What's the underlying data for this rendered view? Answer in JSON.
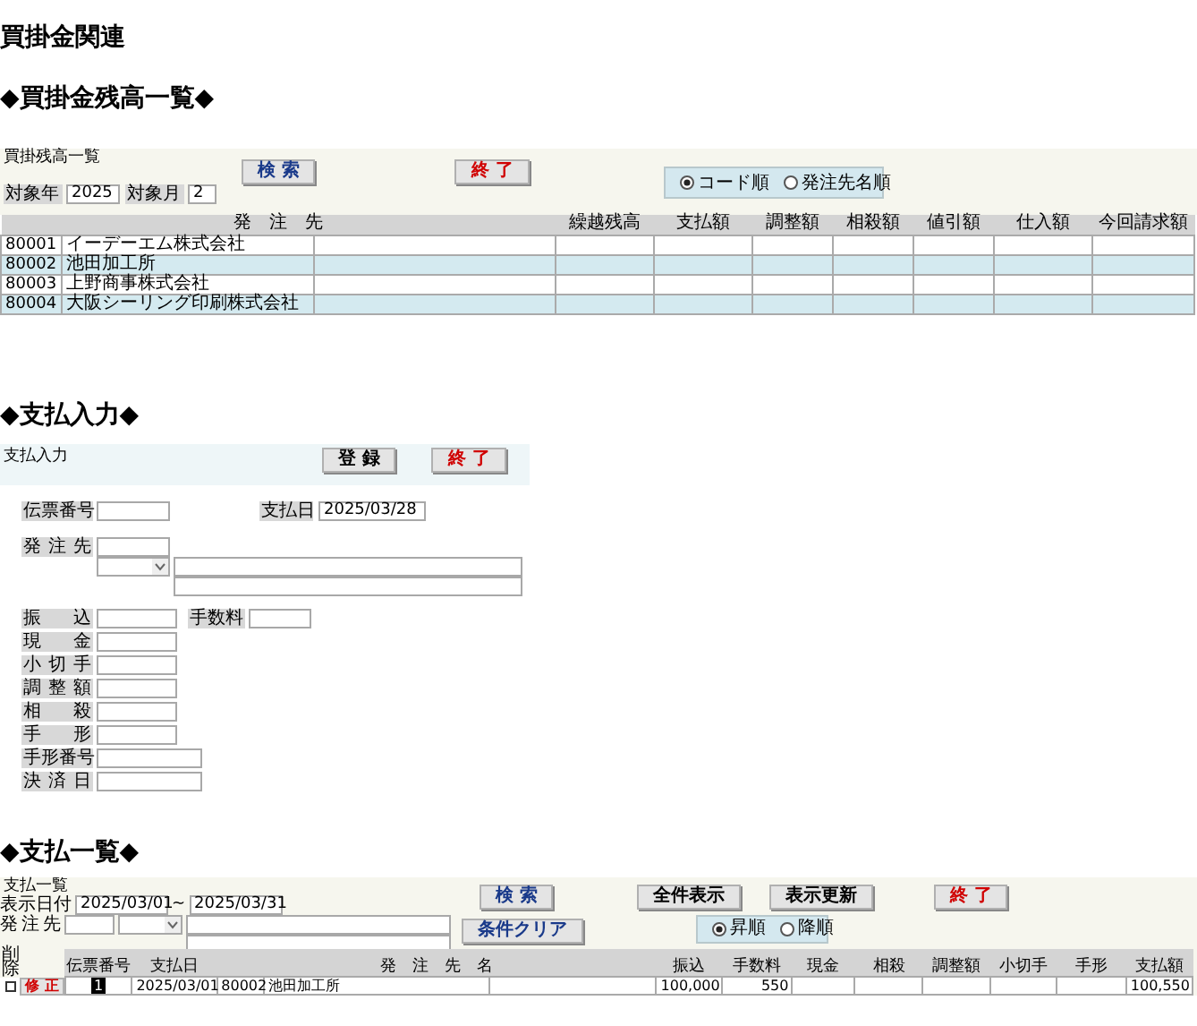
{
  "page_title": "買掛金関連",
  "balance": {
    "heading": "◆買掛金残高一覧◆",
    "panel_label": "買掛残高一覧",
    "buttons": [
      {
        "label": "検 索",
        "kind": "search"
      },
      {
        "label": "終 了",
        "kind": "exit"
      }
    ],
    "filters": [
      {
        "label": "対象年",
        "value": "2025"
      },
      {
        "label": "対象月",
        "value": "2"
      }
    ],
    "sort_options": [
      {
        "label": "コード順",
        "selected": true
      },
      {
        "label": "発注先名順",
        "selected": false
      }
    ],
    "columns": [
      "発　注　先",
      "繰越残高",
      "支払額",
      "調整額",
      "相殺額",
      "値引額",
      "仕入額",
      "今回請求額"
    ],
    "rows": [
      {
        "code": "80001",
        "name": "イーデーエム株式会社"
      },
      {
        "code": "80002",
        "name": "池田加工所"
      },
      {
        "code": "80003",
        "name": "上野商事株式会社"
      },
      {
        "code": "80004",
        "name": "大阪シーリング印刷株式会社"
      }
    ]
  },
  "entry": {
    "heading": "◆支払入力◆",
    "panel_label": "支払入力",
    "buttons": [
      {
        "label": "登 録",
        "kind": "register"
      },
      {
        "label": "終 了",
        "kind": "exit"
      }
    ],
    "slip_label": "伝票番号",
    "date_label": "支払日",
    "date_value": "2025/03/28",
    "supplier_label": "発注先",
    "amounts": [
      {
        "label": "振込",
        "kind": "short"
      },
      {
        "label": "現金",
        "kind": "short"
      },
      {
        "label": "小切手",
        "kind": "short"
      },
      {
        "label": "調整額",
        "kind": "short"
      },
      {
        "label": "相殺",
        "kind": "short"
      },
      {
        "label": "手形",
        "kind": "short"
      },
      {
        "label": "手形番号",
        "kind": "long"
      },
      {
        "label": "決済日",
        "kind": "long"
      }
    ],
    "fee_label": "手数料"
  },
  "list": {
    "heading": "◆支払一覧◆",
    "panel_label": "支払一覧",
    "date_label": "表示日付",
    "date_from": "2025/03/01",
    "range_sep": "~",
    "date_to": "2025/03/31",
    "supplier_label": "発注先",
    "buttons": [
      {
        "label": "検 索",
        "kind": "search"
      },
      {
        "label": "全件表示",
        "kind": "plain"
      },
      {
        "label": "表示更新",
        "kind": "plain"
      },
      {
        "label": "終 了",
        "kind": "exit"
      },
      {
        "label": "条件クリア",
        "kind": "search"
      }
    ],
    "sort_options": [
      {
        "label": "昇順",
        "selected": true
      },
      {
        "label": "降順",
        "selected": false
      }
    ],
    "delete_label": "削除",
    "columns": [
      "伝票番号",
      "支払日",
      "発　注　先　名",
      "振込",
      "手数料",
      "現金",
      "相殺",
      "調整額",
      "小切手",
      "手形",
      "支払額"
    ],
    "rows": [
      {
        "checked": false,
        "edit_label": "修 正",
        "slip": "1",
        "date": "2025/03/01",
        "code": "80002",
        "name": "池田加工所",
        "amounts": [
          "100,000",
          "550"
        ],
        "total": "100,550"
      }
    ]
  }
}
